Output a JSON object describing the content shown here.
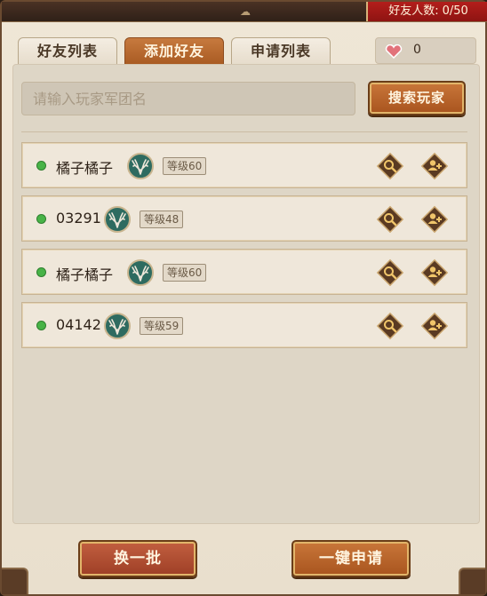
{
  "header": {
    "friends_count_label": "好友人数:",
    "friends_count_value": "0/50"
  },
  "tabs": [
    {
      "label": "好友列表",
      "active": false
    },
    {
      "label": "添加好友",
      "active": true
    },
    {
      "label": "申请列表",
      "active": false
    }
  ],
  "hearts": {
    "icon": "heart-icon",
    "value": "0"
  },
  "search": {
    "placeholder": "请输入玩家军团名",
    "value": "",
    "button_label": "搜索玩家"
  },
  "players": [
    {
      "name": "橘子橘子",
      "level": "等级60",
      "online": true
    },
    {
      "name": "03291",
      "level": "等级48",
      "online": true
    },
    {
      "name": "橘子橘子",
      "level": "等级60",
      "online": true
    },
    {
      "name": "04142",
      "level": "等级59",
      "online": true
    }
  ],
  "footer": {
    "refresh_label": "换一批",
    "apply_all_label": "一键申请"
  },
  "colors": {
    "accent": "#b5652c",
    "online": "#48b347",
    "count_badge": "#a31a18"
  }
}
